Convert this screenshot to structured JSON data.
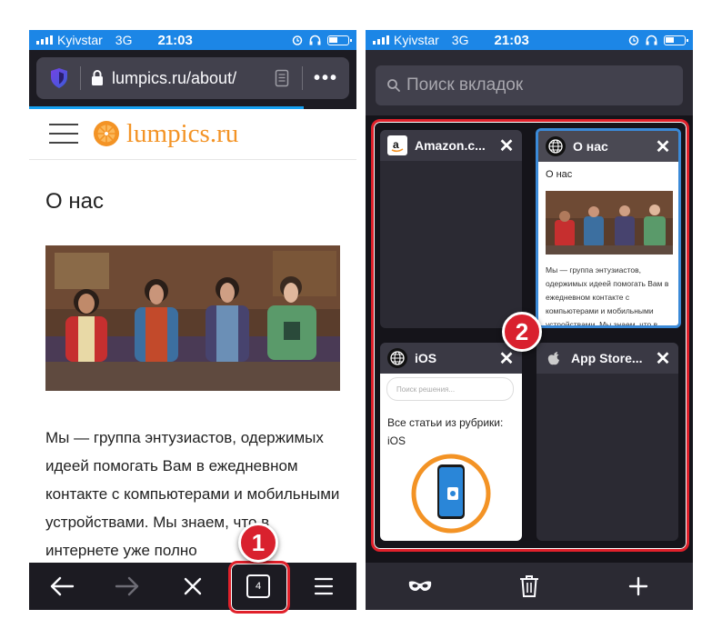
{
  "left_phone": {
    "status": {
      "carrier": "Kyivstar",
      "network": "3G",
      "time": "21:03"
    },
    "url": "lumpics.ru/about/",
    "site_name": "lumpics.ru",
    "page_title": "О нас",
    "body_text": "Мы — группа энтузиастов, одержимых идеей помогать Вам в ежедневном контакте с компьютерами и мобильными устройствами. Мы знаем, что в интернете уже полно",
    "tab_count": "4",
    "toolbar_icons": [
      "back-arrow-icon",
      "forward-arrow-icon",
      "close-icon",
      "tabs-icon",
      "menu-icon"
    ],
    "callout_number": "1"
  },
  "right_phone": {
    "status": {
      "carrier": "Kyivstar",
      "network": "3G",
      "time": "21:03"
    },
    "search_placeholder": "Поиск вкладок",
    "tabs": [
      {
        "title": "Amazon.c...",
        "favicon": "amazon-icon"
      },
      {
        "title": "О нас",
        "favicon": "globe-icon",
        "selected": true,
        "thumb_title": "О нас",
        "thumb_text": "Мы — группа энтузиастов, одержимых идеей помогать Вам в ежедневном контакте с компьютерами и мобильными устройствами. Мы знаем, что в интернете уже полно"
      },
      {
        "title": "iOS",
        "favicon": "globe-icon",
        "thumb_search": "Поиск решения...",
        "thumb_text": "Все статьи из рубрики: iOS"
      },
      {
        "title": "App Store...",
        "favicon": "apple-icon"
      }
    ],
    "toolbar_icons": [
      "private-mask-icon",
      "trash-icon",
      "plus-icon"
    ],
    "callout_number": "2"
  },
  "colors": {
    "status_bar": "#1c86e6",
    "brand_orange": "#f39325",
    "callout_red": "#e0202a",
    "selected_tab_border": "#3b8ad8"
  }
}
